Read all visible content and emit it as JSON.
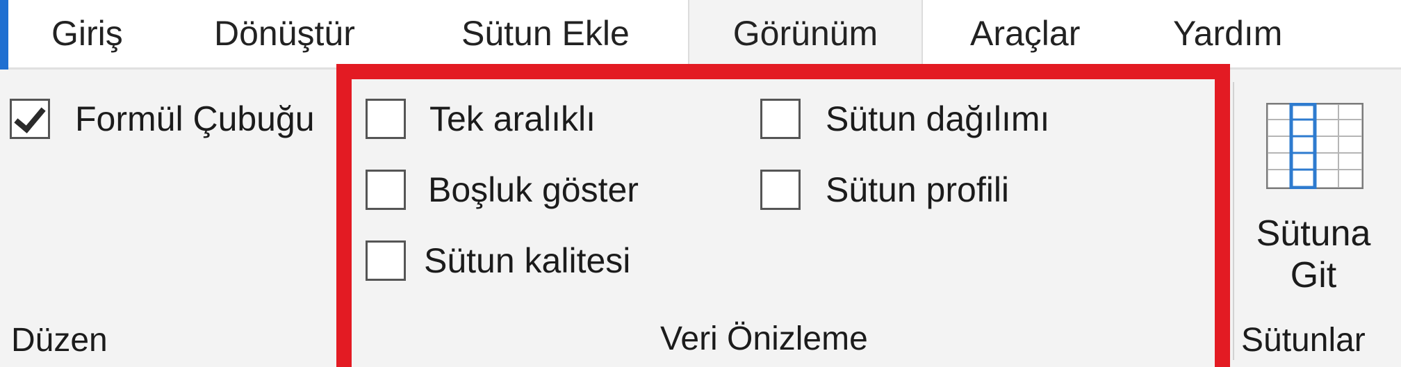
{
  "tabs": [
    {
      "label": "Giriş"
    },
    {
      "label": "Dönüştür"
    },
    {
      "label": "Sütun Ekle"
    },
    {
      "label": "Görünüm",
      "active": true
    },
    {
      "label": "Araçlar"
    },
    {
      "label": "Yardım"
    }
  ],
  "layout_group": {
    "formula_bar": {
      "label": "Formül Çubuğu",
      "checked": true
    },
    "group_label": "Düzen"
  },
  "data_preview_group": {
    "monospaced": {
      "label": "Tek aralıklı",
      "checked": false
    },
    "show_whitespace": {
      "label": "Boşluk göster",
      "checked": false
    },
    "column_quality": {
      "label": "Sütun kalitesi",
      "checked": false
    },
    "column_distribution": {
      "label": "Sütun dağılımı",
      "checked": false
    },
    "column_profile": {
      "label": "Sütun profili",
      "checked": false
    },
    "group_label": "Veri Önizleme"
  },
  "columns_group": {
    "goto_column": {
      "label_line1": "Sütuna",
      "label_line2": "Git",
      "icon": "goto-column-icon"
    },
    "group_label": "Sütunlar"
  },
  "colors": {
    "highlight": "#e31b23",
    "tab_accent": "#1f6fd1",
    "icon_blue": "#2e7bcf"
  }
}
